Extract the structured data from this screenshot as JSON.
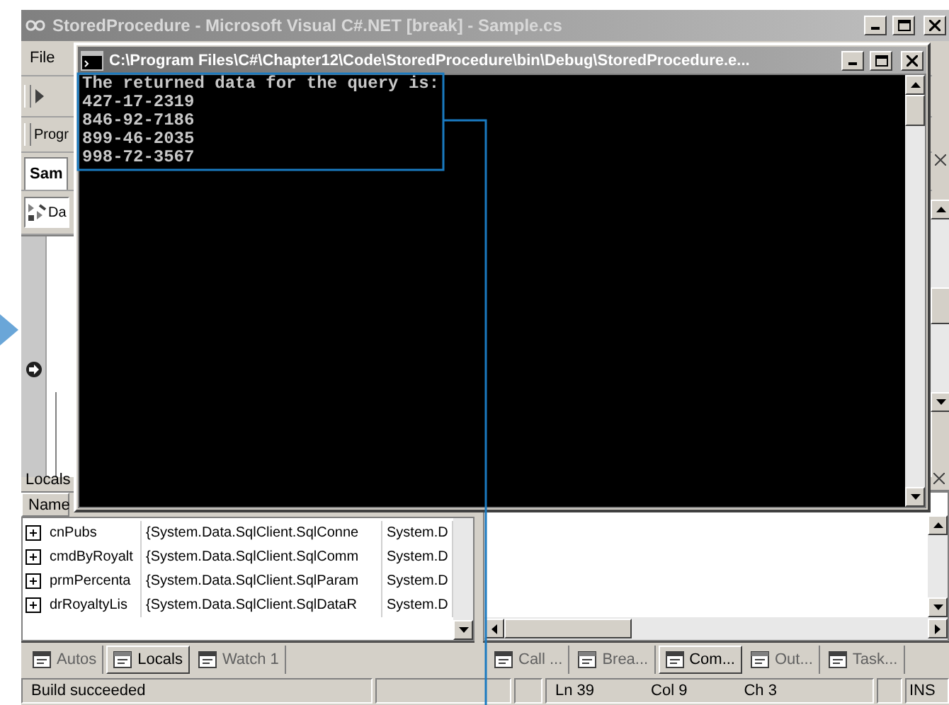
{
  "ide": {
    "title": "StoredProcedure - Microsoft Visual C#.NET [break] - Sample.cs",
    "menu": [
      "File"
    ],
    "toolbar_label": "Progr",
    "document_tab": "Sam",
    "type_dropdown": "Da",
    "locals": {
      "title": "Locals",
      "column": "Name",
      "rows": [
        {
          "name": "cnPubs",
          "value": "{System.Data.SqlClient.SqlConne",
          "type": "System.D"
        },
        {
          "name": "cmdByRoyalt",
          "value": "{System.Data.SqlClient.SqlComm",
          "type": "System.D"
        },
        {
          "name": "prmPercenta",
          "value": "{System.Data.SqlClient.SqlParam",
          "type": "System.D"
        },
        {
          "name": "drRoyaltyLis",
          "value": "{System.Data.SqlClient.SqlDataR",
          "type": "System.D"
        }
      ]
    },
    "left_tabs": [
      {
        "label": "Autos",
        "selected": false
      },
      {
        "label": "Locals",
        "selected": true
      },
      {
        "label": "Watch 1",
        "selected": false
      }
    ],
    "right_tabs": [
      {
        "label": "Call ...",
        "selected": false
      },
      {
        "label": "Brea...",
        "selected": false
      },
      {
        "label": "Com...",
        "selected": true
      },
      {
        "label": "Out...",
        "selected": false
      },
      {
        "label": "Task...",
        "selected": false
      }
    ],
    "status_bar": {
      "message": "Build succeeded",
      "line": "Ln 39",
      "column": "Col 9",
      "char": "Ch 3",
      "mode": "INS"
    }
  },
  "console": {
    "title": "C:\\Program Files\\C#\\Chapter12\\Code\\StoredProcedure\\bin\\Debug\\StoredProcedure.e...",
    "lines": [
      "The returned data for the query is:",
      "427-17-2319",
      "846-92-7186",
      "899-46-2035",
      "998-72-3567"
    ]
  }
}
